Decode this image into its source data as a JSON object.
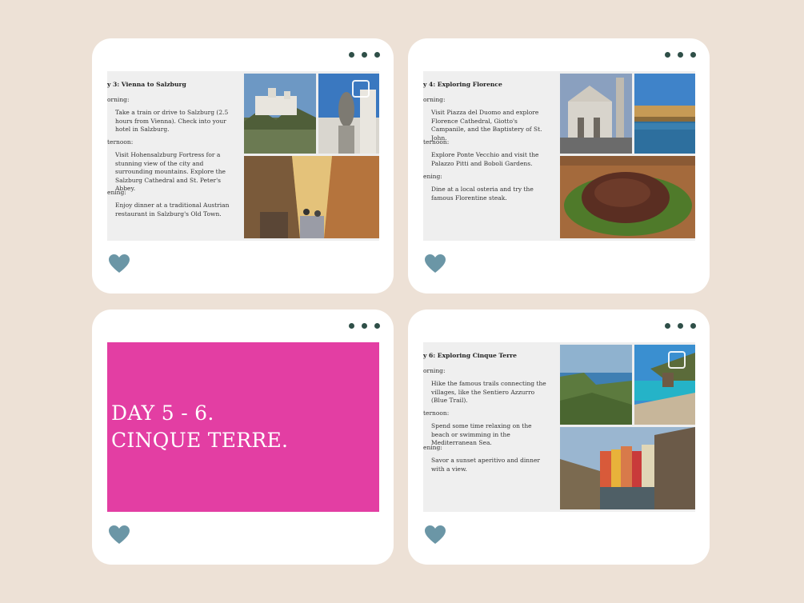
{
  "cards": [
    {
      "title": "y 3: Vienna to Salzburg",
      "periods": [
        {
          "label": "orning:",
          "text": "Take a train or drive to Salzburg (2.5 hours from Vienna). Check into your hotel in Salzburg."
        },
        {
          "label": "ternoon:",
          "text": "Visit Hohensalzburg Fortress for a stunning view of the city and surrounding mountains. Explore the Salzburg Cathedral and St. Peter's Abbey."
        },
        {
          "label": "ening:",
          "text": "Enjoy dinner at a traditional Austrian restaurant in Salzburg's Old Town."
        }
      ]
    },
    {
      "title": "y 4: Exploring Florence",
      "periods": [
        {
          "label": "orning:",
          "text": "Visit Piazza del Duomo and explore Florence Cathedral, Giotto's Campanile, and the Baptistery of St. John."
        },
        {
          "label": "ternoon:",
          "text": "Explore Ponte Vecchio and visit the Palazzo Pitti and Boboli Gardens."
        },
        {
          "label": "ening:",
          "text": "Dine at a local osteria and try the famous Florentine steak."
        }
      ]
    },
    {
      "title_line1": "DAY 5 - 6.",
      "title_line2": "CINQUE TERRE."
    },
    {
      "title": "y 6: Exploring Cinque Terre",
      "periods": [
        {
          "label": "orning:",
          "text": "Hike the famous trails connecting the villages, like the Sentiero Azzurro (Blue Trail)."
        },
        {
          "label": "ternoon:",
          "text": "Spend some time relaxing on the beach or swimming in the Mediterranean Sea."
        },
        {
          "label": "ening:",
          "text": "Savor a sunset aperitivo and dinner with a view."
        }
      ]
    }
  ],
  "colors": {
    "background": "#ede1d6",
    "card": "#ffffff",
    "dots": "#2f4f48",
    "heart": "#6b96a6",
    "pink_slide": "#e33ea3"
  },
  "icons": [
    "more-dots-icon",
    "heart-icon",
    "image-frame-icon"
  ]
}
